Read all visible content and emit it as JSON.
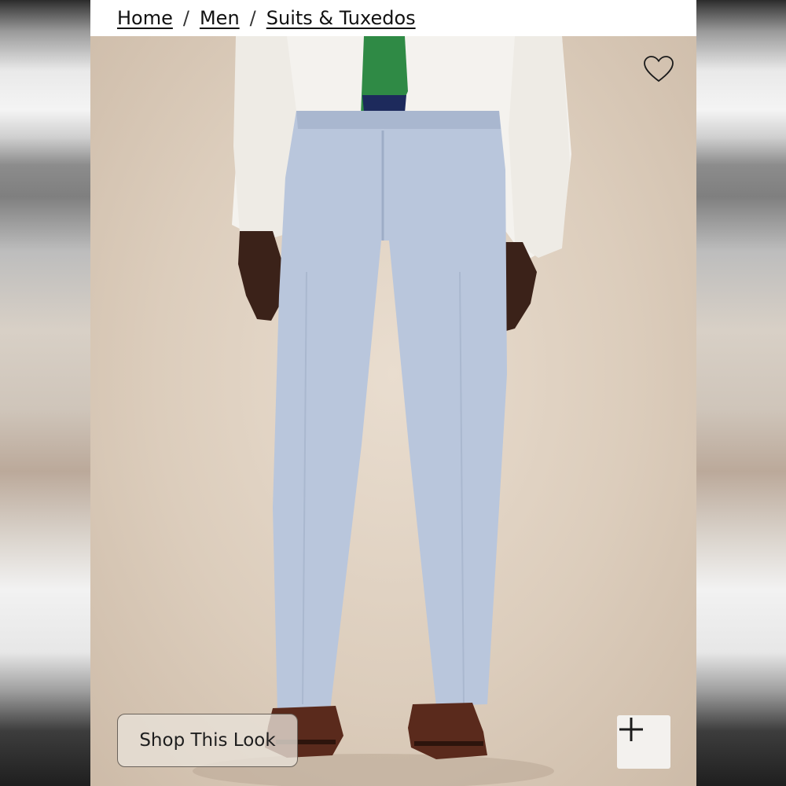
{
  "breadcrumb": {
    "items": [
      "Home",
      "Men",
      "Suits & Tuxedos"
    ],
    "separator": "/"
  },
  "product_image": {
    "favorite_icon": "heart-outline-icon",
    "shop_look_label": "Shop This Look",
    "add_icon": "plus-icon"
  },
  "colors": {
    "backdrop": "#dccdbc",
    "pants": "#b9c6dc",
    "shirt": "#f4f2ee",
    "tie_green": "#2f8a45",
    "tie_navy": "#1d2a5c",
    "shoes": "#5a2a1c"
  }
}
